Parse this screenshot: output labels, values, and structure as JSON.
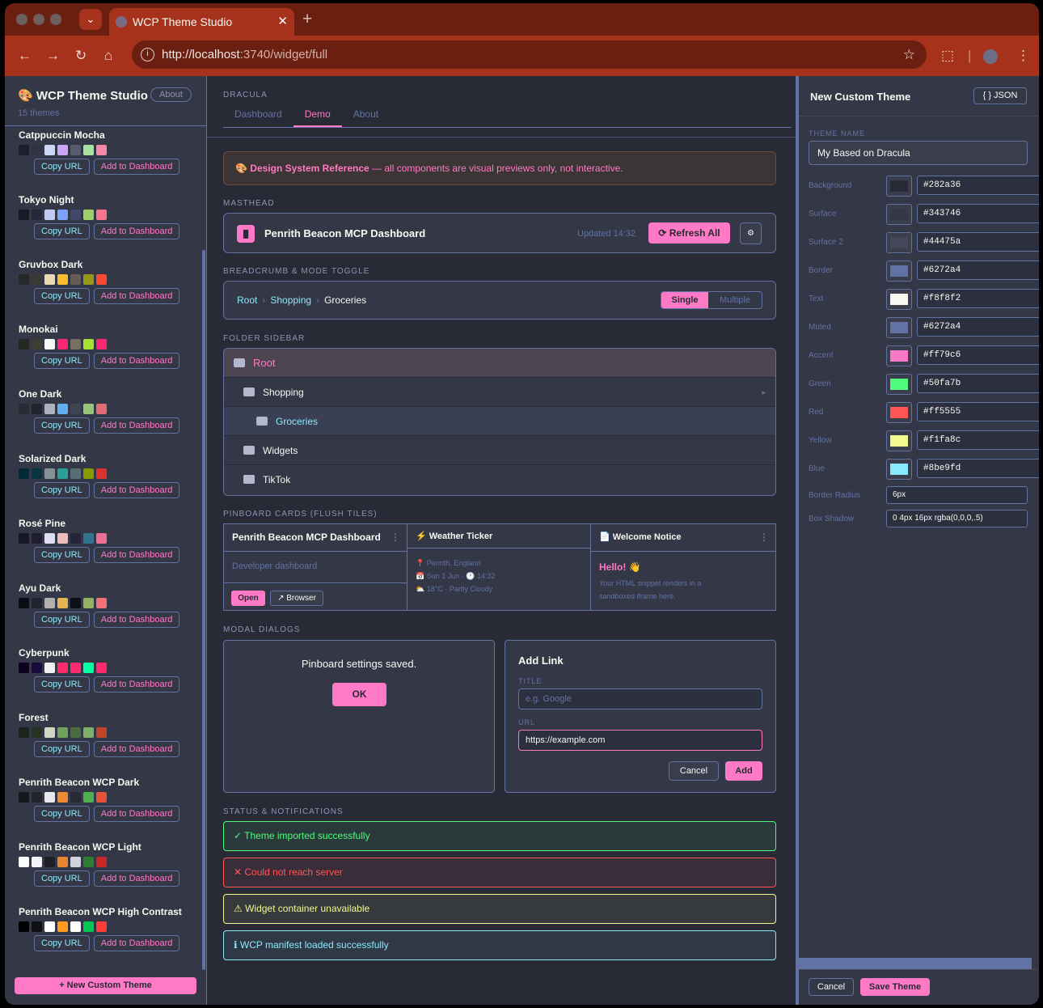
{
  "browser": {
    "tab_title": "WCP Theme Studio",
    "url_host": "http://localhost",
    "url_rest": ":3740/widget/full"
  },
  "sidebar": {
    "title": "🎨 WCP Theme Studio",
    "about_label": "About",
    "count": "15 themes",
    "copy_label": "Copy URL",
    "add_label": "Add to Dashboard",
    "themes": [
      {
        "name": "Catppuccin Mocha",
        "colors": [
          "#1e1e2e",
          "#313244",
          "#cdd6f4",
          "#cba6f7",
          "#585b70",
          "#a6e3a1",
          "#f38ba8"
        ]
      },
      {
        "name": "Tokyo Night",
        "colors": [
          "#1a1b26",
          "#24283b",
          "#c0caf5",
          "#7aa2f7",
          "#414868",
          "#9ece6a",
          "#f7768e"
        ]
      },
      {
        "name": "Gruvbox Dark",
        "colors": [
          "#282828",
          "#3c3836",
          "#ebdbb2",
          "#fabd2f",
          "#665c54",
          "#98971a",
          "#fb4934"
        ]
      },
      {
        "name": "Monokai",
        "colors": [
          "#272822",
          "#3e3d32",
          "#f8f8f2",
          "#f92672",
          "#75715e",
          "#a6e22e",
          "#f92672"
        ]
      },
      {
        "name": "One Dark",
        "colors": [
          "#282c34",
          "#21252b",
          "#abb2bf",
          "#61afef",
          "#3e4451",
          "#98c379",
          "#e06c75"
        ]
      },
      {
        "name": "Solarized Dark",
        "colors": [
          "#002b36",
          "#073642",
          "#839496",
          "#2aa198",
          "#586e75",
          "#859900",
          "#dc322f"
        ]
      },
      {
        "name": "Rosé Pine",
        "colors": [
          "#191724",
          "#1f1d2e",
          "#e0def4",
          "#ebbcba",
          "#26233a",
          "#31748f",
          "#eb6f92"
        ]
      },
      {
        "name": "Ayu Dark",
        "colors": [
          "#0a0e14",
          "#1f2430",
          "#b3b1ad",
          "#e6b450",
          "#0d1016",
          "#91b362",
          "#f07178"
        ]
      },
      {
        "name": "Cyberpunk",
        "colors": [
          "#0d0221",
          "#1a0b3d",
          "#f0f0f0",
          "#ff2a6d",
          "#ff2a6d",
          "#05ffa1",
          "#ff2a6d"
        ]
      },
      {
        "name": "Forest",
        "colors": [
          "#1a2418",
          "#243322",
          "#cfd8c6",
          "#6fa35a",
          "#4a6b3f",
          "#7fb069",
          "#c0442b"
        ]
      },
      {
        "name": "Penrith Beacon WCP Dark",
        "colors": [
          "#16171d",
          "#22242c",
          "#e8e8ee",
          "#ee8a32",
          "#282a36",
          "#4caf50",
          "#e5533d"
        ]
      },
      {
        "name": "Penrith Beacon WCP Light",
        "colors": [
          "#ffffff",
          "#f4f4f6",
          "#1e1f26",
          "#e8852e",
          "#d0d3da",
          "#2e7d32",
          "#c62828"
        ]
      },
      {
        "name": "Penrith Beacon WCP High Contrast",
        "colors": [
          "#000000",
          "#101010",
          "#ffffff",
          "#ff9a1f",
          "#ffffff",
          "#00c853",
          "#ff3d3d"
        ]
      }
    ],
    "new_custom_label": "+ New Custom Theme"
  },
  "main": {
    "theme_label": "DRACULA",
    "tabs": [
      "Dashboard",
      "Demo",
      "About"
    ],
    "banner_bold": "🎨 Design System Reference",
    "banner_text": " — all components are visual previews only, not interactive.",
    "sections": {
      "masthead": "MASTHEAD",
      "breadcrumb": "BREADCRUMB & MODE TOGGLE",
      "folder": "FOLDER SIDEBAR",
      "pinboard": "PINBOARD CARDS (FLUSH TILES)",
      "modal": "MODAL DIALOGS",
      "status": "STATUS & NOTIFICATIONS"
    },
    "masthead": {
      "title": "Penrith Beacon MCP Dashboard",
      "updated": "Updated 14:32",
      "refresh_label": "⟳ Refresh All",
      "gear": "⚙"
    },
    "breadcrumb": {
      "items": [
        "Root",
        "Shopping",
        "Groceries"
      ],
      "sep": "›",
      "toggle": [
        "Single",
        "Multiple"
      ]
    },
    "folders": [
      {
        "name": "Root"
      },
      {
        "name": "Shopping",
        "arrow": "▸"
      },
      {
        "name": "Groceries"
      },
      {
        "name": "Widgets"
      },
      {
        "name": "TikTok"
      }
    ],
    "pins": {
      "card1": {
        "title": "Penrith Beacon MCP Dashboard",
        "subtitle": "Developer dashboard",
        "open": "Open",
        "browser": "↗ Browser"
      },
      "card2": {
        "title": "⚡ Weather Ticker",
        "line1": "📍 Penrith, England",
        "line2": "📅 Sun 1 Jun · 🕐 14:32",
        "line3": "⛅ 18°C · Partly Cloudy"
      },
      "card3": {
        "title": "📄 Welcome Notice",
        "hello": "Hello! 👋",
        "body1": "Your HTML snippet renders in a",
        "body2": "sandboxed iframe here."
      },
      "dots": "⋮"
    },
    "modal1": {
      "message": "Pinboard settings saved.",
      "ok": "OK"
    },
    "modal2": {
      "title": "Add Link",
      "title_label": "TITLE",
      "title_placeholder": "e.g. Google",
      "url_label": "URL",
      "url_value": "https://example.com",
      "cancel": "Cancel",
      "add": "Add"
    },
    "statuses": [
      {
        "text": "✓ Theme imported successfully",
        "color": "#50fa7b"
      },
      {
        "text": "✕ Could not reach server",
        "color": "#ff5555"
      },
      {
        "text": "⚠ Widget container unavailable",
        "color": "#f1fa8c"
      },
      {
        "text": "ℹ WCP manifest loaded successfully",
        "color": "#8be9fd"
      }
    ]
  },
  "editor": {
    "title": "New Custom Theme",
    "json_label": "{ } JSON",
    "name_label": "THEME NAME",
    "name_value": "My Based on Dracula",
    "colors": [
      {
        "label": "Background",
        "value": "#282a36"
      },
      {
        "label": "Surface",
        "value": "#343746"
      },
      {
        "label": "Surface 2",
        "value": "#44475a"
      },
      {
        "label": "Border",
        "value": "#6272a4"
      },
      {
        "label": "Text",
        "value": "#f8f8f2"
      },
      {
        "label": "Muted",
        "value": "#6272a4"
      },
      {
        "label": "Accent",
        "value": "#ff79c6"
      },
      {
        "label": "Green",
        "value": "#50fa7b"
      },
      {
        "label": "Red",
        "value": "#ff5555"
      },
      {
        "label": "Yellow",
        "value": "#f1fa8c"
      },
      {
        "label": "Blue",
        "value": "#8be9fd"
      }
    ],
    "radius_label": "Border Radius",
    "radius_value": "6px",
    "shadow_label": "Box Shadow",
    "shadow_value": "0 4px 16px rgba(0,0,0,.5)",
    "cancel": "Cancel",
    "save": "Save Theme"
  }
}
